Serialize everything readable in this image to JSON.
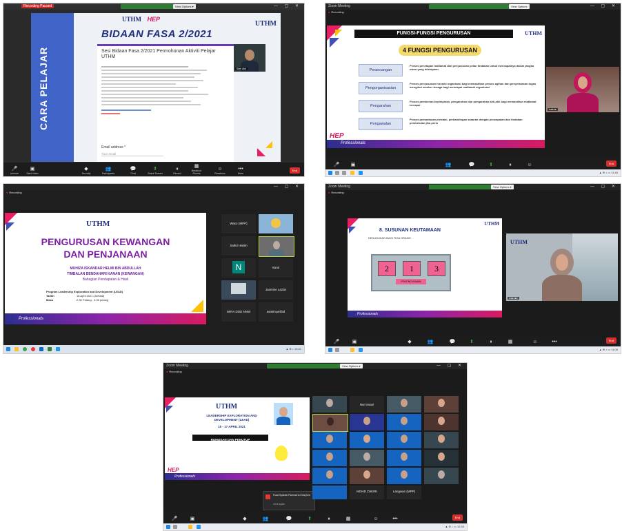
{
  "shot1": {
    "recording_btn": "Recording Paused",
    "sidebar_title": "CARA PELAJAR",
    "header_title": "BIDAAN FASA 2/2021",
    "form_title": "Sesi Bidaan Fasa 2/2021 Permohonan Aktiviti Pelajar UTHM",
    "form_lines": [
      "",
      "",
      "",
      "",
      "",
      "",
      "",
      "",
      "",
      "",
      "",
      "",
      ""
    ],
    "email_label": "Email address *",
    "email_placeholder": "Your email",
    "logos": {
      "uthm": "UTHM",
      "hep": "HEP"
    },
    "speaker_name": "Sam Abd",
    "toolbar": [
      "Unmute",
      "Start Video",
      "Security",
      "Participants",
      "Chat",
      "Share Screen",
      "Record",
      "Breakout Rooms",
      "Reactions",
      "More"
    ]
  },
  "shot2": {
    "app_title": "Zoom Meeting",
    "recording": "Recording",
    "view_options": "View Options",
    "slide_header": "FUNGSI-FUNGSI PENGURUSAN",
    "slide_subtitle": "4 FUNGSI PENGURUSAN",
    "functions": [
      {
        "name": "Perancangan",
        "desc": "Proses penetapan matlamat dan penyusunan pelan tindakan untuk mencapainya dalam jangka masa yang ditetapkan"
      },
      {
        "name": "Pengorganisasian",
        "desc": "Proses penyusunan hierarki organisasi bagi memastikan proses agihan dan penyelarasan tugas mengikut sumber tenaga bagi mencapai matlamat organisasi"
      },
      {
        "name": "Pengarahan",
        "desc": "Proses pemberian kepimpinan, pengaruhan dan pengarahan ahli-ahli bagi memastikan matlamat tercapai"
      },
      {
        "name": "Pengawalan",
        "desc": "Proses pemantauan prestasi, perbandingan sasaran dengan pencapaian dan tindakan pembetulan jika perlu"
      }
    ],
    "footer_brand": "Professionals",
    "end_label": "End"
  },
  "shot3": {
    "recording": "Recording",
    "slide_title_1": "PENGURUSAN KEWANGAN",
    "slide_title_2": "DAN PENJANAAN",
    "presenter_name": "MUHIZA ISKANDAR HELMI BIN ABDULLAH",
    "presenter_role": "TIMBALAN BENDAHARI KANAN (KEWANGAN)",
    "presenter_dept": "Bahagian Pendapatan & Hasil",
    "program_label": "Program Leadership Exploration and Development (LEAD)",
    "date_label": "Tarikh",
    "date_value": "16 April 2021 (Jumaat)",
    "time_label": "Masa",
    "time_value": "2.30 Petang - 3.30 petang",
    "footer_brand": "Professionals",
    "participants": [
      "Wanz (MPP)",
      "",
      "Saiful Hakim",
      "",
      "",
      "Sarul",
      "",
      "Jasmine Lazlar",
      "WIRA DDD NNW",
      "awaimyarifad"
    ]
  },
  "shot4": {
    "app_title": "Zoom Meeting",
    "recording": "Recording",
    "slide_title": "8. SUSUNAN KEUTAMAAN",
    "slide_subtitle": "KEDUDUKAN BAGI TIGA ORANG",
    "ranks": [
      "2",
      "1",
      "3"
    ],
    "rank_label": "PENTING KAWAN",
    "footer_brand": "Professionals"
  },
  "shot5": {
    "app_title": "Zoom Meeting",
    "recording": "Recording",
    "program_title": "LEADERSHIP EXPLORATION AND DEVELOPMENT (LEAD)",
    "program_date": "15 - 17 APRIL 2021",
    "section_title": "RUMUSAN DAN PENUTUP",
    "footer_brand": "Professionals",
    "notification_text": "Fuad Syakirin Rahmat to Everyone",
    "notification_sub": "Click again",
    "gallery_names": [
      "",
      "Nur Insani",
      "",
      "",
      "",
      "",
      "",
      "",
      "",
      "",
      "",
      "",
      "",
      "",
      "",
      "",
      "",
      "",
      "",
      "",
      "",
      "MOHD ZUKIRI",
      "Langwan (MPP)",
      ""
    ]
  }
}
